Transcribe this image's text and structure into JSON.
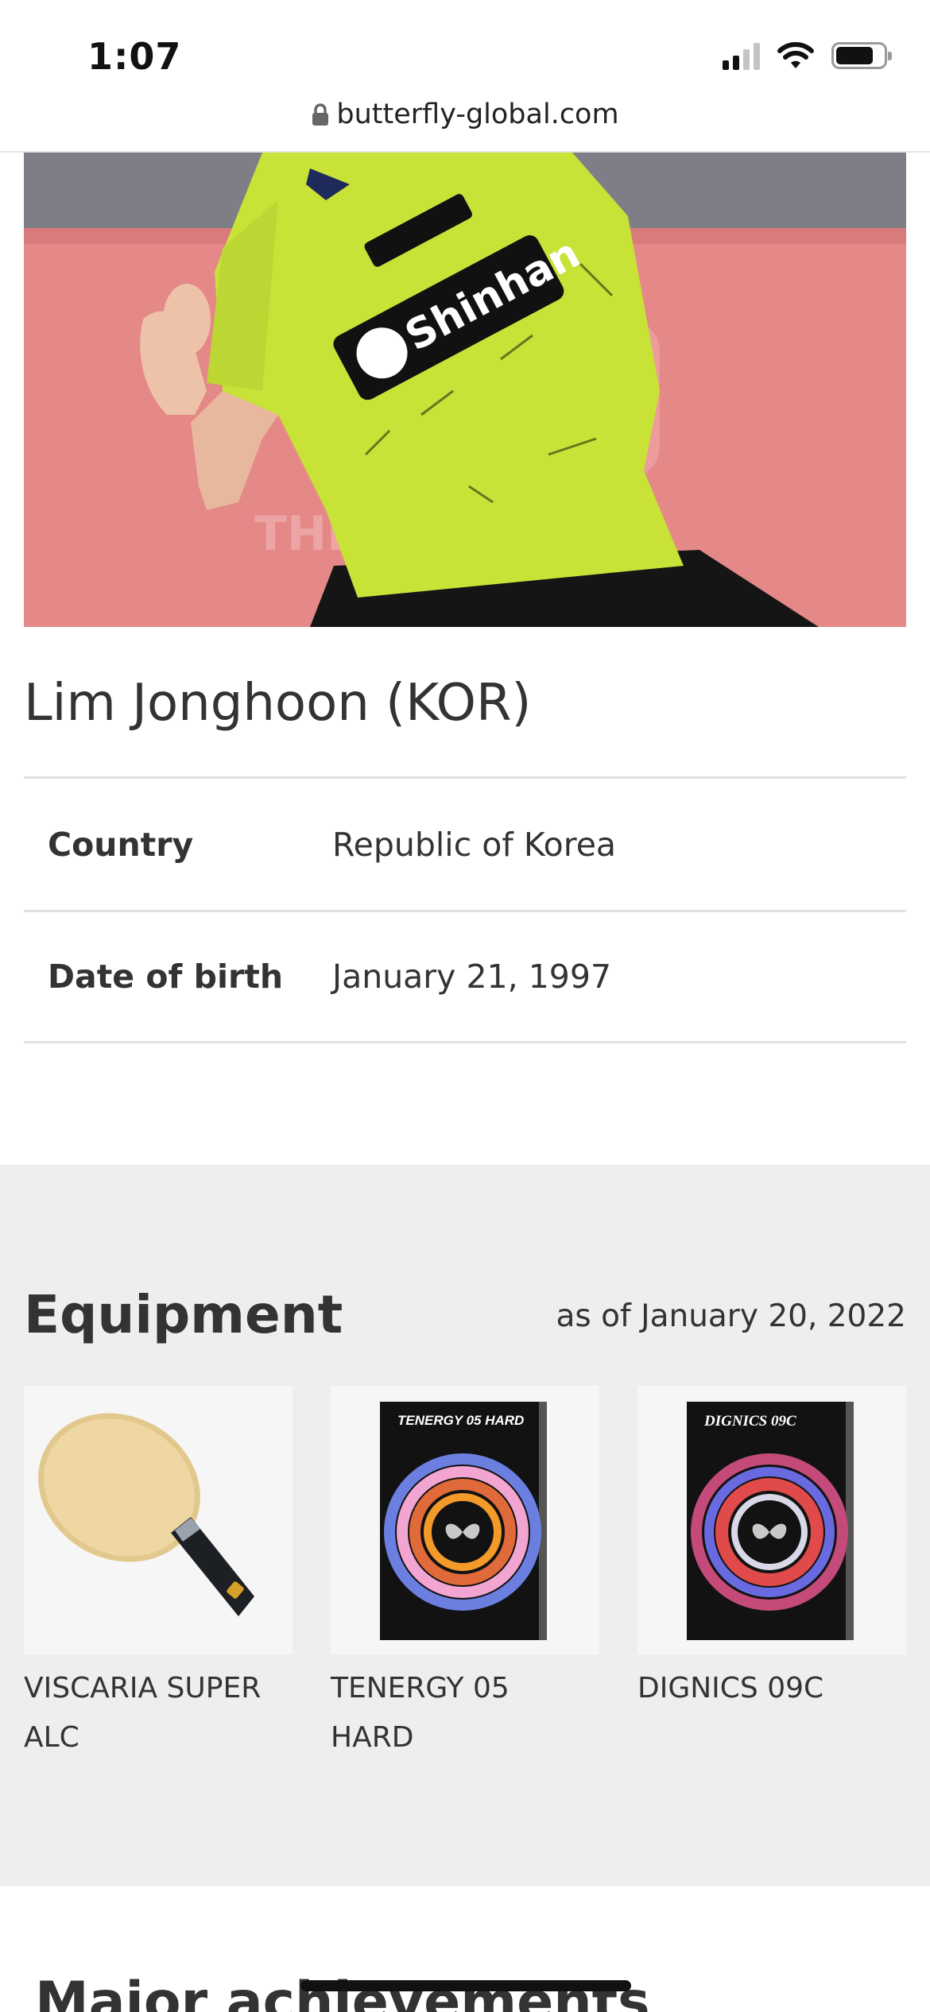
{
  "status_bar": {
    "time": "1:07",
    "signal_icon": "cellular-signal-icon",
    "wifi_icon": "wifi-icon",
    "battery_icon": "battery-icon"
  },
  "browser": {
    "url": "butterfly-global.com",
    "lock_icon": "lock-icon"
  },
  "hero": {
    "jersey_sponsor": "Shinhan",
    "colors": {
      "jersey": "#c9e238",
      "background": "#e88c8c",
      "shorts": "#151515"
    }
  },
  "player": {
    "name": "Lim Jonghoon (KOR)",
    "info": [
      {
        "label": "Country",
        "value": "Republic of Korea"
      },
      {
        "label": "Date of birth",
        "value": "January 21, 1997"
      }
    ]
  },
  "equipment": {
    "title": "Equipment",
    "as_of": "as of January 20, 2022",
    "items": [
      {
        "name": "VISCARIA SUPER ALC",
        "icon": "racket-blade-icon"
      },
      {
        "name": "TENERGY 05 HARD",
        "icon": "rubber-package-icon",
        "package_label": "TENERGY 05 HARD"
      },
      {
        "name": "DIGNICS 09C",
        "icon": "rubber-package-icon",
        "package_label": "DIGNICS 09C"
      }
    ]
  },
  "achievements": {
    "title": "Major achievements"
  }
}
